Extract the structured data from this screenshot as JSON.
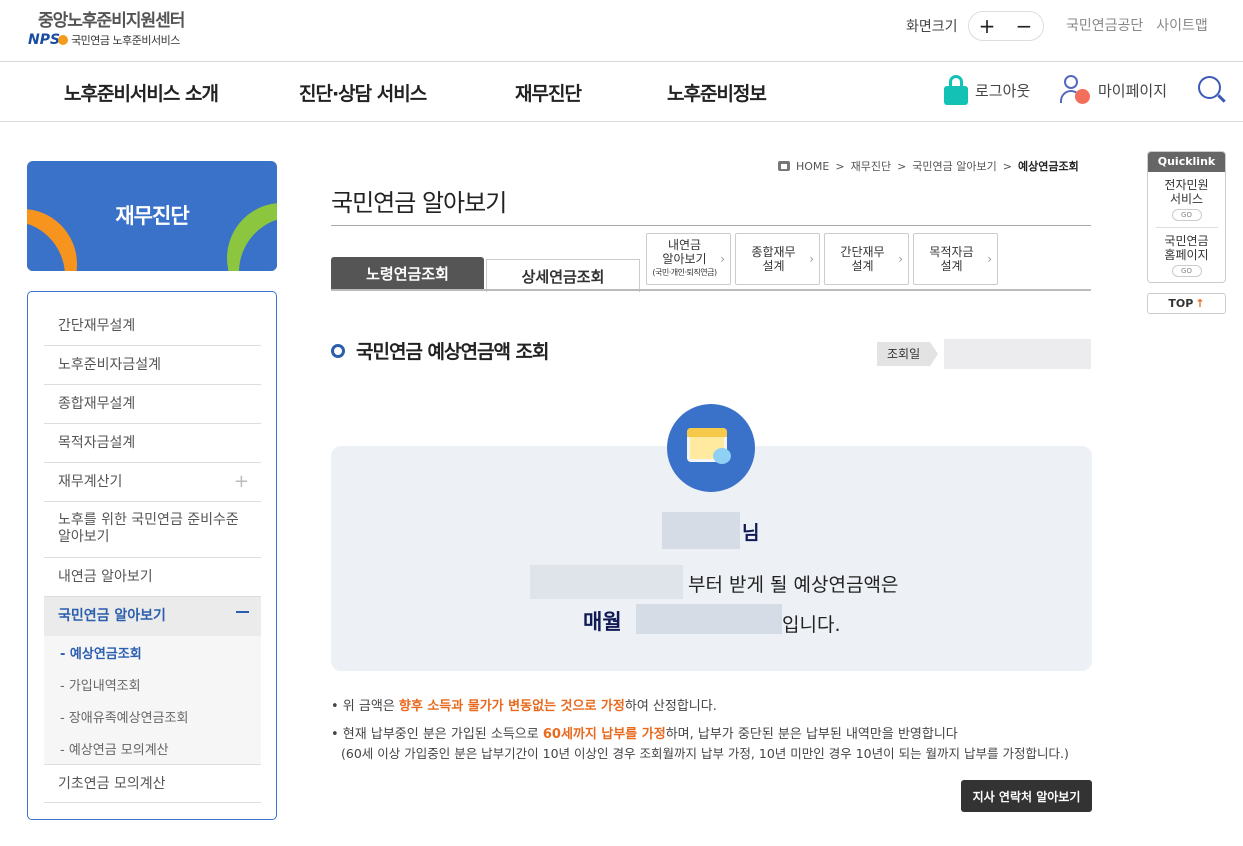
{
  "header": {
    "logo_title": "중앙노후준비지원센터",
    "logo_brand": "NPS",
    "logo_sub": "국민연금 노후준비서비스",
    "font_size_label": "화면크기",
    "font_plus": "+",
    "font_minus": "−",
    "links": [
      "국민연금공단",
      "사이트맵"
    ]
  },
  "gnb": {
    "items": [
      "노후준비서비스 소개",
      "진단·상담 서비스",
      "재무진단",
      "노후준비정보"
    ],
    "logout": "로그아웃",
    "mypage": "마이페이지"
  },
  "lnb": {
    "title": "재무진단",
    "items": [
      "간단재무설계",
      "노후준비자금설계",
      "종합재무설계",
      "목적자금설계",
      "재무계산기",
      "노후를 위한 국민연금 준비수준 알아보기",
      "내연금 알아보기",
      "국민연금 알아보기",
      "기초연금 모의계산"
    ],
    "sub_items": [
      "- 예상연금조회",
      "- 가입내역조회",
      "- 장애유족예상연금조회",
      "- 예상연금 모의계산"
    ]
  },
  "breadcrumb": {
    "home": "HOME",
    "sep": ">",
    "items": [
      "재무진단",
      "국민연금 알아보기",
      "예상연금조회"
    ]
  },
  "page": {
    "title": "국민연금 알아보기",
    "tabs": [
      "노령연금조회",
      "상세연금조회"
    ],
    "sub_buttons": [
      {
        "l1": "내연금",
        "l2": "알아보기",
        "small": "(국민·개인·퇴직연금)"
      },
      {
        "l1": "종합재무",
        "l2": "설계"
      },
      {
        "l1": "간단재무",
        "l2": "설계"
      },
      {
        "l1": "목적자금",
        "l2": "설계"
      }
    ],
    "section_title": "국민연금 예상연금액 조회",
    "query_date_label": "조회일"
  },
  "result": {
    "name_suffix": "님",
    "line2_suffix": "부터 받게 될 예상연금액은",
    "monthly": "매월",
    "line3_suffix": "입니다."
  },
  "notes": {
    "n1_pre": "• 위 금액은 ",
    "n1_hl": "향후 소득과 물가가 변동없는 것으로 가정",
    "n1_post": "하여 산정합니다.",
    "n2_pre": "• 현재 납부중인 분은 가입된 소득으로 ",
    "n2_hl": "60세까지 납부를 가정",
    "n2_post": "하며, 납부가 중단된 분은 납부된 내역만을 반영합니다",
    "n3": "(60세 이상 가입중인 분은 납부기간이 10년 이상인 경우 조회월까지 납부 가정, 10년 미만인 경우 10년이 되는 월까지 납부를 가정합니다.)",
    "branch_button": "지사 연락처 알아보기"
  },
  "quicklink": {
    "title": "Quicklink",
    "item1_l1": "전자민원",
    "item1_l2": "서비스",
    "item2_l1": "국민연금",
    "item2_l2": "홈페이지",
    "go": "GO",
    "top": "TOP"
  },
  "colors": {
    "brand_blue": "#3b72c9",
    "accent_orange": "#e86a1f",
    "lock_teal": "#13c2b5"
  }
}
